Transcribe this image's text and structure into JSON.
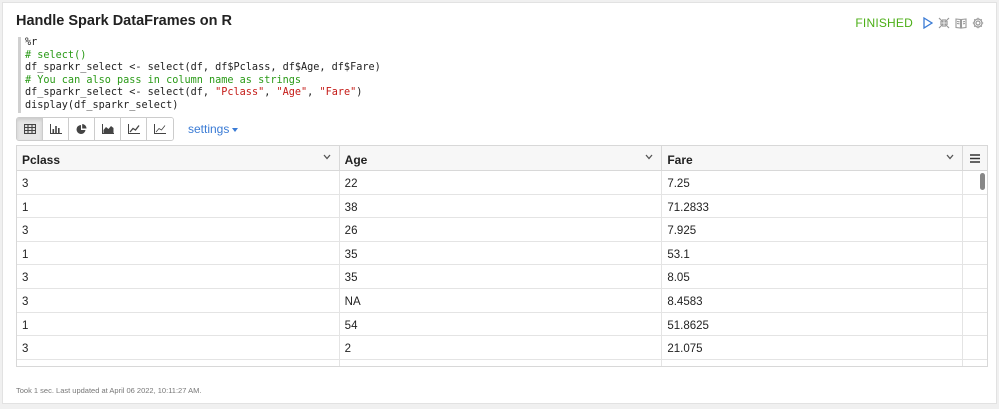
{
  "paragraph": {
    "title": "Handle Spark DataFrames on R",
    "status": "FINISHED",
    "footer": "Took 1 sec. Last updated at April 06 2022, 10:11:27 AM."
  },
  "code": {
    "lines": [
      {
        "text": "%r",
        "kind": "plain"
      },
      {
        "text": "# select()",
        "kind": "comment"
      },
      {
        "text": "df_sparkr_select <- select(df, df$Pclass, df$Age, df$Fare)",
        "kind": "plain"
      },
      {
        "text": "# You can also pass in column name as strings",
        "kind": "comment"
      },
      {
        "text": "df_sparkr_select <- select(df, ",
        "kind": "plain",
        "strings": [
          "\"Pclass\"",
          ", ",
          "\"Age\"",
          ", ",
          "\"Fare\"",
          ")"
        ]
      },
      {
        "text": "display(df_sparkr_select)",
        "kind": "plain"
      }
    ]
  },
  "toolbar": {
    "buttons": [
      "table-icon",
      "bar-chart-icon",
      "pie-chart-icon",
      "area-chart-icon",
      "line-chart-icon",
      "scatter-chart-icon"
    ],
    "active": "table-icon",
    "settings_label": "settings"
  },
  "table": {
    "columns": [
      "Pclass",
      "Age",
      "Fare"
    ],
    "rows": [
      [
        "3",
        "22",
        "7.25"
      ],
      [
        "1",
        "38",
        "71.2833"
      ],
      [
        "3",
        "26",
        "7.925"
      ],
      [
        "1",
        "35",
        "53.1"
      ],
      [
        "3",
        "35",
        "8.05"
      ],
      [
        "3",
        "NA",
        "8.4583"
      ],
      [
        "1",
        "54",
        "51.8625"
      ],
      [
        "3",
        "2",
        "21.075"
      ],
      [
        "",
        "",
        ""
      ]
    ]
  },
  "colors": {
    "status": "#4caf17",
    "link": "#3a7bd5",
    "comment": "#2a9a17",
    "string": "#c41a16"
  }
}
